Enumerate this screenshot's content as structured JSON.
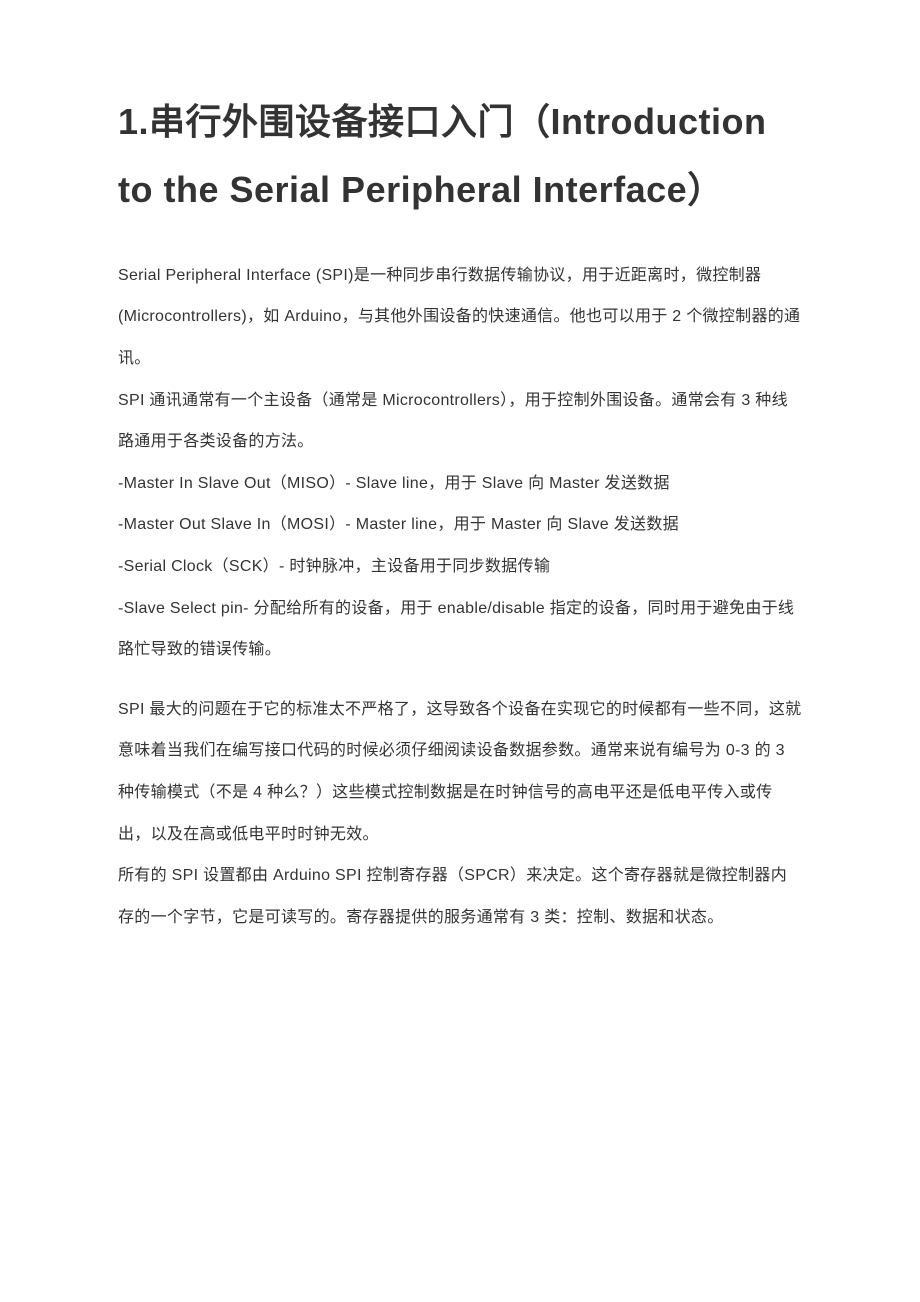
{
  "heading": "1.串行外围设备接口入门（Introduction to the Serial Peripheral Interface）",
  "p1": "Serial Peripheral Interface (SPI)是一种同步串行数据传输协议，用于近距离时，微控制器(Microcontrollers)，如 Arduino，与其他外围设备的快速通信。他也可以用于 2 个微控制器的通讯。",
  "p2": "SPI 通讯通常有一个主设备（通常是 Microcontrollers），用于控制外围设备。通常会有 3 种线路通用于各类设备的方法。",
  "p3": "-Master In Slave Out（MISO）- Slave line，用于 Slave 向 Master 发送数据",
  "p4": "-Master Out Slave In（MOSI）- Master line，用于 Master 向 Slave 发送数据",
  "p5": "-Serial Clock（SCK）- 时钟脉冲，主设备用于同步数据传输",
  "p6": "-Slave Select pin- 分配给所有的设备，用于 enable/disable 指定的设备，同时用于避免由于线路忙导致的错误传输。",
  "p7": "SPI 最大的问题在于它的标准太不严格了，这导致各个设备在实现它的时候都有一些不同，这就意味着当我们在编写接口代码的时候必须仔细阅读设备数据参数。通常来说有编号为 0-3 的 3 种传输模式（不是 4 种么？）这些模式控制数据是在时钟信号的高电平还是低电平传入或传出，以及在高或低电平时时钟无效。",
  "p8": "所有的 SPI 设置都由 Arduino SPI 控制寄存器（SPCR）来决定。这个寄存器就是微控制器内存的一个字节，它是可读写的。寄存器提供的服务通常有 3 类：控制、数据和状态。"
}
